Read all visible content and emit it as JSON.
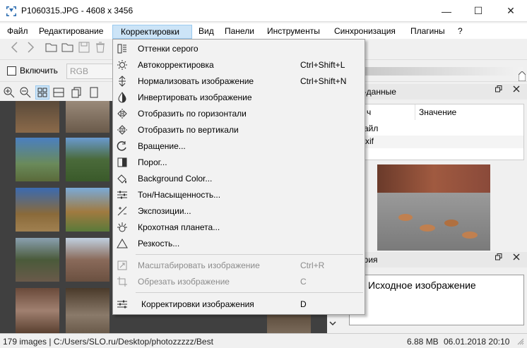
{
  "window": {
    "title": "P1060315.JPG  - 4608 x 3456",
    "minimize_glyph": "—",
    "maximize_glyph": "☐",
    "close_glyph": "✕"
  },
  "menubar": [
    {
      "label": "Файл"
    },
    {
      "label": "Редактирование"
    },
    {
      "label": "Корректировки"
    },
    {
      "label": "Вид"
    },
    {
      "label": "Панели"
    },
    {
      "label": "Инструменты"
    },
    {
      "label": "Синхронизация"
    },
    {
      "label": "Плагины"
    },
    {
      "label": "?"
    }
  ],
  "adjust_bar": {
    "enable_label": "Включить",
    "channel_value": "RGB"
  },
  "dropdown": {
    "items": [
      {
        "label": "Оттенки серого",
        "shortcut": "",
        "icon": "grayscale-icon"
      },
      {
        "label": "Автокорректировка",
        "shortcut": "Ctrl+Shift+L",
        "icon": "sun-icon"
      },
      {
        "label": "Нормализовать изображение",
        "shortcut": "Ctrl+Shift+N",
        "icon": "normalize-icon"
      },
      {
        "label": "Инвертировать изображение",
        "shortcut": "",
        "icon": "invert-icon"
      },
      {
        "label": "Отобразить по горизонтали",
        "shortcut": "",
        "icon": "flip-horizontal-icon"
      },
      {
        "label": "Отобразить по вертикали",
        "shortcut": "",
        "icon": "flip-vertical-icon"
      },
      {
        "label": "Вращение...",
        "shortcut": "",
        "icon": "rotate-icon"
      },
      {
        "label": "Порог...",
        "shortcut": "",
        "icon": "threshold-icon"
      },
      {
        "label": "Background Color...",
        "shortcut": "",
        "icon": "paint-bucket-icon"
      },
      {
        "label": "Тон/Насыщенность...",
        "shortcut": "",
        "icon": "sliders-icon"
      },
      {
        "label": " Экспозиции...",
        "shortcut": "",
        "icon": "exposure-icon"
      },
      {
        "label": "Крохотная планета...",
        "shortcut": "",
        "icon": "planet-icon"
      },
      {
        "label": "Резкость...",
        "shortcut": "",
        "icon": "sharpen-icon"
      }
    ],
    "disabled_items": [
      {
        "label": "Масштабировать изображение",
        "shortcut": "Ctrl+R",
        "icon": "resize-icon"
      },
      {
        "label": "Обрезать изображение",
        "shortcut": "C",
        "icon": "crop-icon"
      }
    ],
    "last_item": {
      "label": "Корректировки изображения",
      "shortcut": "D",
      "icon": "adjustments-icon"
    }
  },
  "metadata_panel": {
    "header": "а-данные",
    "col_name": "ч",
    "col_value": "Значение",
    "rows": [
      {
        "name": "айл"
      },
      {
        "name": "xif"
      }
    ]
  },
  "history_panel": {
    "header": "ория",
    "item": "Исходное изображение"
  },
  "statusbar": {
    "count_path": "179 images | C:/Users/SLO.ru/Desktop/photozzzzz/Best",
    "size": "6.88 MB",
    "datetime": "06.01.2018 20:10"
  },
  "colors": {
    "menu_active_bg": "#cce4f7",
    "menu_active_border": "#99c9ef",
    "thumb_panel_bg": "#404040",
    "dropdown_bg": "#f2f2f2"
  }
}
